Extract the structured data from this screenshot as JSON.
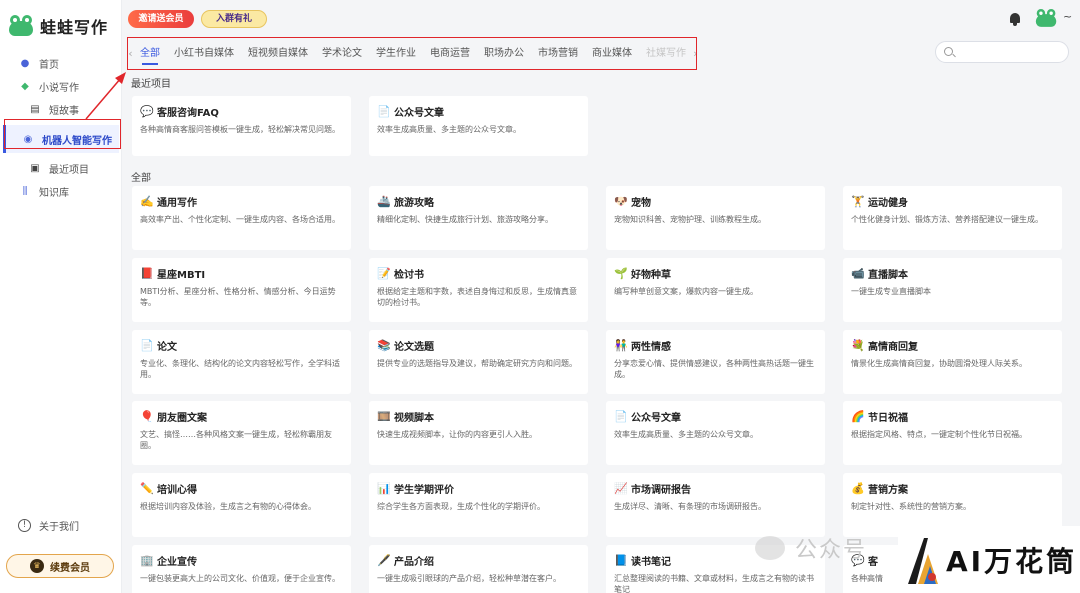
{
  "app": {
    "name": "蛙蛙写作"
  },
  "sidebar": {
    "items": [
      {
        "label": "首页",
        "icon": "home-icon"
      },
      {
        "label": "小说写作",
        "icon": "frog-icon"
      },
      {
        "label": "短故事",
        "icon": "book-icon"
      },
      {
        "label": "机器人智能写作",
        "icon": "robot-icon",
        "active": true
      },
      {
        "label": "最近项目",
        "icon": "calendar-icon"
      },
      {
        "label": "知识库",
        "icon": "library-icon"
      }
    ],
    "about_label": "关于我们",
    "vip_label": "续费会员"
  },
  "topbar": {
    "badge_invite": "邀请送会员",
    "badge_group": "入群有礼",
    "user_menu": "~"
  },
  "tabs": [
    "全部",
    "小红书自媒体",
    "短视频自媒体",
    "学术论文",
    "学生作业",
    "电商运营",
    "职场办公",
    "市场营销",
    "商业媒体",
    "社媒写作"
  ],
  "search": {
    "placeholder": ""
  },
  "recent": {
    "title": "最近项目",
    "cards": [
      {
        "icon": "💬",
        "title": "客服咨询FAQ",
        "desc": "各种高情商客服问答模板一键生成，轻松解决常见问题。"
      },
      {
        "icon": "📄",
        "title": "公众号文章",
        "desc": "效率生成高质量、多主题的公众号文章。"
      }
    ]
  },
  "all": {
    "title": "全部",
    "cards": [
      {
        "icon": "✍️",
        "title": "通用写作",
        "desc": "高效率产出、个性化定制、一键生成内容、各场合适用。"
      },
      {
        "icon": "🚢",
        "title": "旅游攻略",
        "desc": "精细化定制、快捷生成旅行计划、旅游攻略分享。"
      },
      {
        "icon": "🐶",
        "title": "宠物",
        "desc": "宠物知识科普、宠物护理、训练教程生成。"
      },
      {
        "icon": "🏋️",
        "title": "运动健身",
        "desc": "个性化健身计划、锻炼方法、营养搭配建议一键生成。"
      },
      {
        "icon": "📕",
        "title": "星座MBTI",
        "desc": "MBTI分析、星座分析、性格分析、情感分析、今日运势等。"
      },
      {
        "icon": "📝",
        "title": "检讨书",
        "desc": "根据给定主题和字数，表述自身悔过和反思，生成情真意切的检讨书。"
      },
      {
        "icon": "🌱",
        "title": "好物种草",
        "desc": "编写种草创意文案，爆款内容一键生成。"
      },
      {
        "icon": "📹",
        "title": "直播脚本",
        "desc": "一键生成专业直播脚本"
      },
      {
        "icon": "📄",
        "title": "论文",
        "desc": "专业化、条理化、结构化的论文内容轻松写作，全学科适用。"
      },
      {
        "icon": "📚",
        "title": "论文选题",
        "desc": "提供专业的选题指导及建议，帮助确定研究方向和问题。"
      },
      {
        "icon": "👫",
        "title": "两性情感",
        "desc": "分享恋爱心情、提供情感建议，各种两性高热话题一键生成。"
      },
      {
        "icon": "💐",
        "title": "高情商回复",
        "desc": "情景化生成高情商回复，协助圆滑处理人际关系。"
      },
      {
        "icon": "🎈",
        "title": "朋友圈文案",
        "desc": "文艺、搞怪……各种风格文案一键生成，轻松称霸朋友圈。"
      },
      {
        "icon": "🎞️",
        "title": "视频脚本",
        "desc": "快速生成视频脚本，让你的内容更引人入胜。"
      },
      {
        "icon": "📄",
        "title": "公众号文章",
        "desc": "效率生成高质量、多主题的公众号文章。"
      },
      {
        "icon": "🌈",
        "title": "节日祝福",
        "desc": "根据指定风格、特点，一键定制个性化节日祝福。"
      },
      {
        "icon": "✏️",
        "title": "培训心得",
        "desc": "根据培训内容及体验，生成言之有物的心得体会。"
      },
      {
        "icon": "📊",
        "title": "学生学期评价",
        "desc": "综合学生各方面表现，生成个性化的学期评价。"
      },
      {
        "icon": "📈",
        "title": "市场调研报告",
        "desc": "生成详尽、清晰、有条理的市场调研报告。"
      },
      {
        "icon": "💰",
        "title": "营销方案",
        "desc": "制定针对性、系统性的营销方案。"
      },
      {
        "icon": "🏢",
        "title": "企业宣传",
        "desc": "一键包装更高大上的公司文化、价值观，便于企业宣传。"
      },
      {
        "icon": "🖋️",
        "title": "产品介绍",
        "desc": "一键生成吸引眼球的产品介绍，轻松种草潜在客户。"
      },
      {
        "icon": "📘",
        "title": "读书笔记",
        "desc": "汇总整理阅读的书籍、文章或材料，生成言之有物的读书笔记"
      },
      {
        "icon": "💬",
        "title": "客",
        "desc": "各种高情"
      }
    ]
  },
  "watermark": {
    "text": "公众号",
    "brand": "AI万花筒"
  },
  "colors": {
    "accent": "#3a59e0",
    "highlight": "#e0262b",
    "frog": "#3fb86e"
  }
}
